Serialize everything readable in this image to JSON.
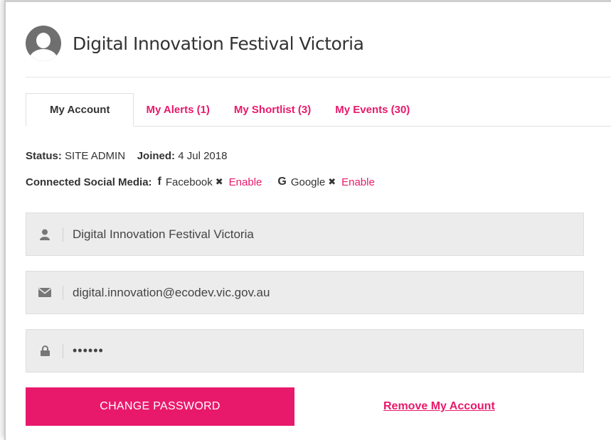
{
  "header": {
    "title": "Digital Innovation Festival Victoria",
    "avatar_icon": "user-silhouette-icon"
  },
  "tabs": [
    {
      "label": "My Account",
      "active": true
    },
    {
      "label": "My Alerts (1)",
      "active": false
    },
    {
      "label": "My Shortlist (3)",
      "active": false
    },
    {
      "label": "My Events (30)",
      "active": false
    }
  ],
  "account": {
    "status_label": "Status:",
    "status_value": "SITE ADMIN",
    "joined_label": "Joined:",
    "joined_value": "4 Jul 2018",
    "social_label": "Connected Social Media:",
    "facebook_icon": "f",
    "facebook_label": "Facebook",
    "facebook_remove_icon": "✖",
    "facebook_enable": "Enable",
    "google_icon": "G",
    "google_label": "Google",
    "google_remove_icon": "✖",
    "google_enable": "Enable"
  },
  "fields": {
    "name_value": "Digital Innovation Festival Victoria",
    "email_value": "digital.innovation@ecodev.vic.gov.au",
    "password_value": "••••••"
  },
  "actions": {
    "change_password": "CHANGE PASSWORD",
    "remove_account": "Remove My Account"
  },
  "colors": {
    "accent": "#e8196b",
    "field_bg": "#ececec"
  }
}
